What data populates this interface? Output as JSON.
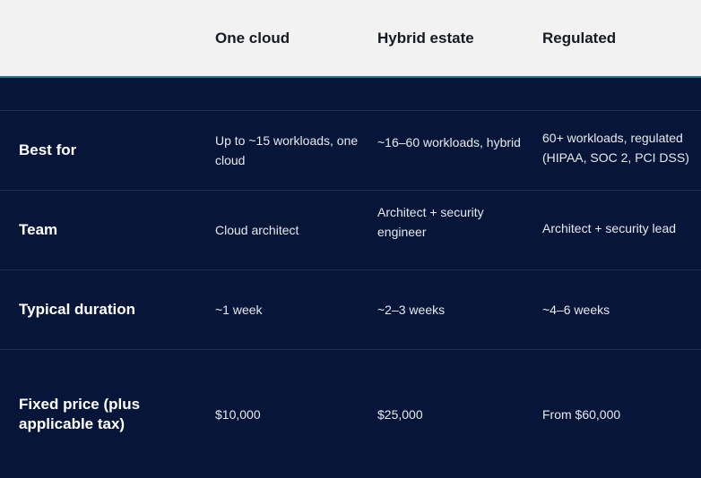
{
  "columns": [
    "",
    "One cloud",
    "Hybrid estate",
    "Regulated"
  ],
  "rows": [
    {
      "label": "Best for",
      "values": [
        "Up to ~15 workloads, one cloud",
        "~16–60 workloads, hybrid",
        "60+ workloads, regulated (HIPAA, SOC 2, PCI DSS)"
      ]
    },
    {
      "label": "Team",
      "values": [
        "Cloud architect",
        "Architect + security engineer",
        "Architect + security lead"
      ]
    },
    {
      "label": "Typical duration",
      "values": [
        "~1 week",
        "~2–3 weeks",
        "~4–6 weeks"
      ]
    },
    {
      "label": "Fixed price (plus applicable tax)",
      "values": [
        "$10,000",
        "$25,000",
        "From $60,000"
      ]
    }
  ],
  "colors": {
    "header_bg": "#f2f2f2",
    "body_bg": "#071638",
    "accent_line": "#2e6f8a"
  }
}
